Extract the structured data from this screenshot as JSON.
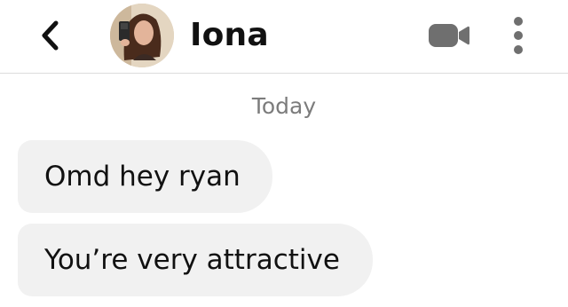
{
  "header": {
    "contact_name": "Iona",
    "back_icon": "chevron-left-icon",
    "video_icon": "video-camera-icon",
    "more_icon": "vertical-dots-icon",
    "avatar": "profile-photo"
  },
  "conversation": {
    "date_label": "Today",
    "messages": [
      {
        "text": "Omd hey ryan",
        "sender": "contact"
      },
      {
        "text": "You’re very attractive",
        "sender": "contact"
      }
    ]
  },
  "colors": {
    "bubble_background": "#f1f1f1",
    "text": "#111111",
    "date_text": "#7c7c7c",
    "icon": "#6f6f6f",
    "divider": "#dcdcdc"
  }
}
